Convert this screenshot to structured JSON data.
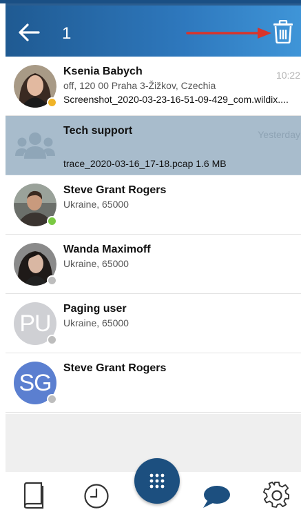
{
  "header": {
    "selected_count": "1"
  },
  "colors": {
    "header_start": "#1f5a92",
    "header_end": "#3f95d8",
    "selected_row": "#a8bccc",
    "fab": "#1c4f7f",
    "annotation_arrow": "#d9342b",
    "status_away": "#f0b429",
    "status_online": "#7ac943",
    "status_offline": "#bdbdbd"
  },
  "conversations": [
    {
      "name": "Ksenia Babych",
      "subtitle": "off, 120 00 Praha 3-Žižkov, Czechia",
      "last_message": "Screenshot_2020-03-23-16-51-09-429_com.wildix....",
      "time": "10:22",
      "status": "away"
    },
    {
      "name": "Tech support",
      "last_message": "trace_2020-03-16_17-18.pcap 1.6 MB",
      "time": "Yesterday",
      "selected": true,
      "icon": "group-icon"
    },
    {
      "name": "Steve Grant Rogers",
      "subtitle": "Ukraine, 65000",
      "status": "online"
    },
    {
      "name": "Wanda Maximoff",
      "subtitle": "Ukraine, 65000",
      "status": "offline"
    },
    {
      "name": "Paging user",
      "subtitle": "Ukraine, 65000",
      "initials": "PU",
      "avatar_color": "#cfd0d4",
      "status": "offline"
    },
    {
      "name": "Steve Grant Rogers",
      "initials": "SG",
      "avatar_color": "#5b7fd0",
      "status": "offline"
    }
  ],
  "bottom_nav": {
    "items": [
      "phonebook-icon",
      "history-icon",
      "dialpad-icon",
      "chat-icon",
      "settings-icon"
    ]
  }
}
